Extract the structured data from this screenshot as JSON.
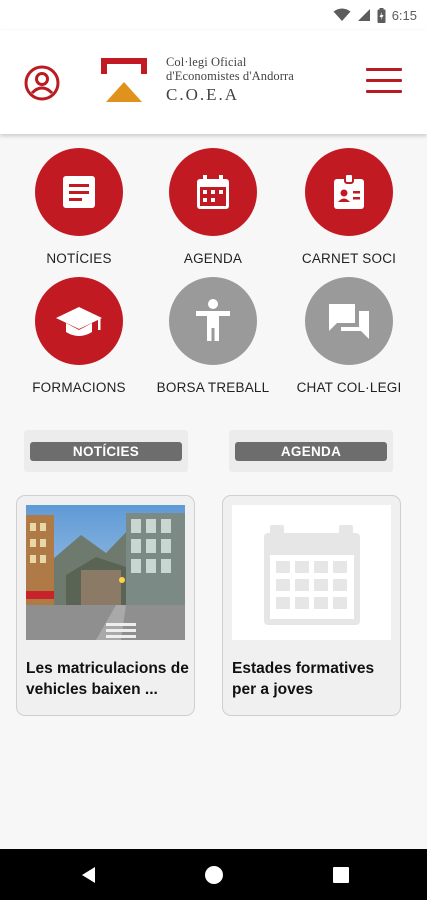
{
  "status_bar": {
    "time": "6:15",
    "icons": [
      "wifi-icon",
      "signal-icon",
      "battery-icon"
    ]
  },
  "header": {
    "org_line1": "Col·legi Oficial",
    "org_line2": "d'Economistes d'Andorra",
    "org_acronym": "C.O.E.A",
    "icons": [
      "profile-icon",
      "logo-icon",
      "hamburger-menu-icon"
    ]
  },
  "tiles": [
    {
      "label": "NOTÍCIES",
      "icon": "news-icon",
      "color": "#c21a22"
    },
    {
      "label": "AGENDA",
      "icon": "calendar-icon",
      "color": "#c21a22"
    },
    {
      "label": "CARNET SOCI",
      "icon": "id-card-icon",
      "color": "#c21a22"
    },
    {
      "label": "FORMACIONS",
      "icon": "graduation-cap-icon",
      "color": "#c21a22"
    },
    {
      "label": "BORSA TREBALL",
      "icon": "person-icon",
      "color": "#9a9a9a"
    },
    {
      "label": "CHAT COL·LEGI",
      "icon": "chat-icon",
      "color": "#9a9a9a"
    }
  ],
  "sections": {
    "news": "NOTÍCIES",
    "agenda": "AGENDA"
  },
  "cards": [
    {
      "title": "Les matriculacions de vehicles baixen ...",
      "image": "street-photo"
    },
    {
      "title": "Estades formatives per a joves",
      "image": "calendar-placeholder-icon"
    }
  ],
  "nav": {
    "icons": [
      "back-icon",
      "home-icon",
      "recents-icon"
    ]
  },
  "colors": {
    "brand_red": "#c21a22",
    "logo_orange": "#e0921c",
    "disabled_grey": "#9a9a9a"
  }
}
